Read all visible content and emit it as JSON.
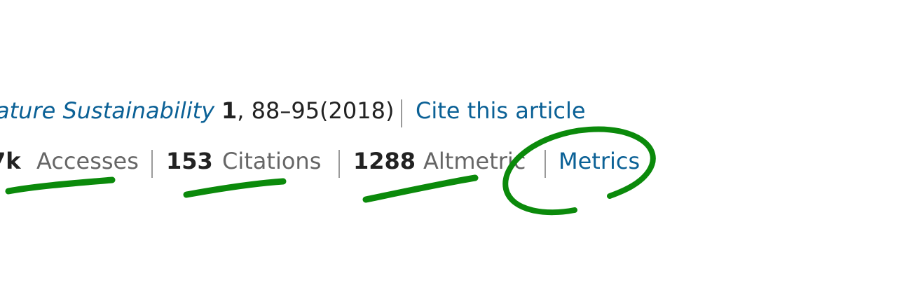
{
  "citation": {
    "journal": "ature Sustainability",
    "volume": "1",
    "pages_year": ", 88–95(2018)",
    "cite_link": "Cite this article"
  },
  "metrics": {
    "accesses": {
      "value": "7k",
      "label": "Accesses"
    },
    "citations": {
      "value": "153",
      "label": "Citations"
    },
    "altmetric": {
      "value": "1288",
      "label": "Altmetric"
    },
    "metrics_link": "Metrics"
  },
  "annotation": {
    "ink_color": "#0b8a0b"
  }
}
